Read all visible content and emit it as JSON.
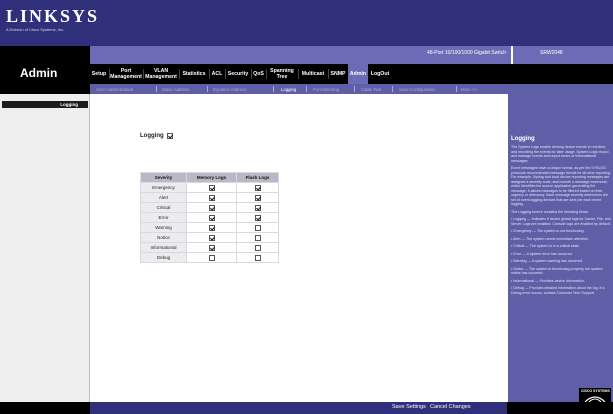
{
  "brand": {
    "name": "LINKSYS",
    "tagline": "A Division of Cisco Systems, Inc."
  },
  "product": {
    "description": "48-Port 10/100/1000 Gigabit Switch",
    "model": "SRW2048"
  },
  "section": {
    "title": "Admin"
  },
  "nav": {
    "items": [
      {
        "label": "Setup"
      },
      {
        "label": "Port Management"
      },
      {
        "label": "VLAN Management"
      },
      {
        "label": "Statistics"
      },
      {
        "label": "ACL"
      },
      {
        "label": "Security"
      },
      {
        "label": "QoS"
      },
      {
        "label": "Spanning Tree"
      },
      {
        "label": "Multicast"
      },
      {
        "label": "SNMP"
      },
      {
        "label": "Admin"
      },
      {
        "label": "LogOut"
      }
    ],
    "active": "Admin"
  },
  "subnav": {
    "items": [
      {
        "label": "User Authentication"
      },
      {
        "label": "Static Address"
      },
      {
        "label": "Dynamic Address"
      },
      {
        "label": "Logging"
      },
      {
        "label": "Port Mirroring"
      },
      {
        "label": "Cable Test"
      },
      {
        "label": "Save Configuration"
      },
      {
        "label": "More >>"
      }
    ],
    "active": "Logging"
  },
  "sidebar": {
    "selected_label": "Logging"
  },
  "form": {
    "logging_label": "Logging",
    "logging_enabled": true,
    "table_headers": [
      "Severity",
      "Memory Logs",
      "Flash Logs"
    ],
    "rows": [
      {
        "severity": "Emergency",
        "memory": true,
        "flash": true
      },
      {
        "severity": "Alert",
        "memory": true,
        "flash": true
      },
      {
        "severity": "Critical",
        "memory": true,
        "flash": true
      },
      {
        "severity": "Error",
        "memory": true,
        "flash": true
      },
      {
        "severity": "Warning",
        "memory": true,
        "flash": false
      },
      {
        "severity": "Notice",
        "memory": true,
        "flash": false
      },
      {
        "severity": "Informational",
        "memory": true,
        "flash": false
      },
      {
        "severity": "Debug",
        "memory": false,
        "flash": false
      }
    ]
  },
  "help": {
    "title": "Logging",
    "paragraphs": [
      "The System Logs enable viewing device events in real time, and recording the events for later usage. System Logs record and manage events and report errors or informational messages.",
      "Event messages have a unique format, as per the SYSLOG protocols recommended message format for all error reporting. For example, Syslog and local device reporting messages are assigned a severity code, and include a message mnemonic, which identifies the source application generating the message. It allows messages to be filtered based on their urgency or relevancy. Each message severity determines the set of event logging devices that are sent per each event logging.",
      "The Logging screen contains the following fields:",
      "• Logging — Indicates if device global logs for Cache, File, and Server Logs are enabled. Console logs are enabled by default.",
      "• Emergency — The system is not functioning.",
      "• Alert — The system needs immediate attention.",
      "• Critical — The system is in a critical state.",
      "• Error — A system error has occurred.",
      "• Warning — A system warning has occurred.",
      "• Notice — The system is functioning properly, but system notice has occurred.",
      "• Informational — Provides device information.",
      "• Debug — Provides detailed information about the log. If a Debug error occurs, contact Customer Tech Support."
    ]
  },
  "footer": {
    "save_label": "Save Settings",
    "cancel_label": "Cancel Changes"
  },
  "cisco": {
    "label": "CISCO SYSTEMS"
  },
  "colors": {
    "banner": "#2f2f7a",
    "nav_active": "#6b6bb6",
    "help_bg": "#5f5fa8",
    "nav_bg": "#000000"
  }
}
